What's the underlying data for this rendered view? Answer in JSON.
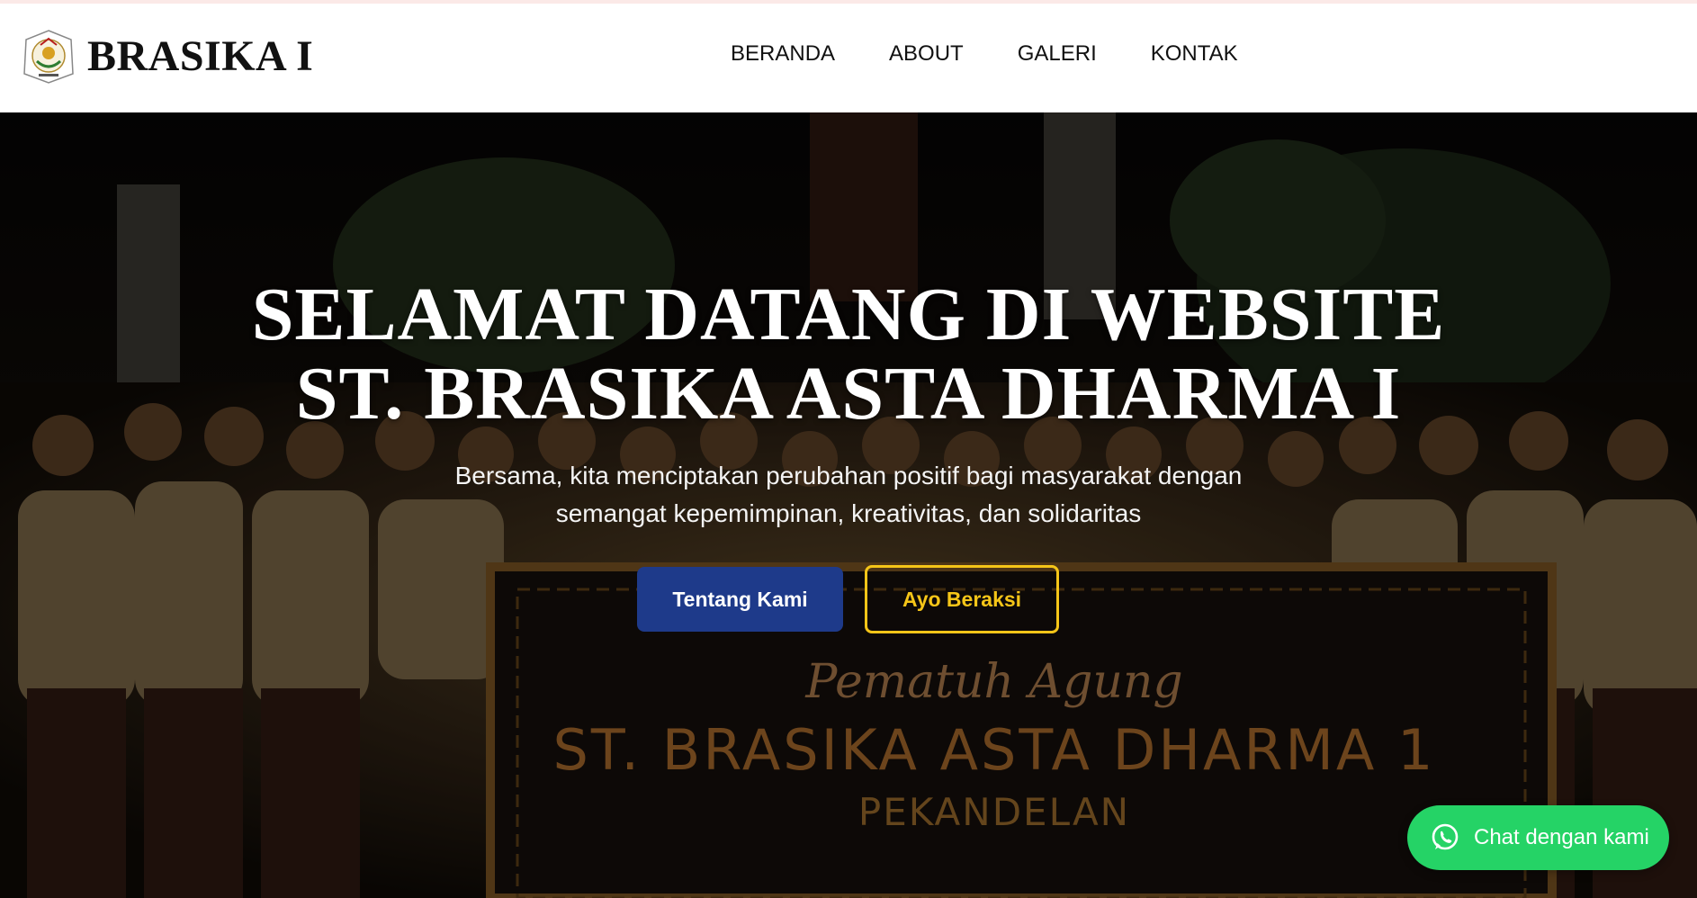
{
  "brand": {
    "name": "BRASIKA I",
    "logo_icon": "organization-emblem-icon"
  },
  "nav": {
    "items": [
      "BERANDA",
      "ABOUT",
      "GALERI",
      "KONTAK"
    ]
  },
  "hero": {
    "title_line1": "SELAMAT DATANG DI WEBSITE",
    "title_line2": "ST. BRASIKA ASTA DHARMA I",
    "subtitle_line1": "Bersama, kita menciptakan perubahan positif bagi masyarakat dengan",
    "subtitle_line2": "semangat kepemimpinan, kreativitas, dan solidaritas",
    "primary_button": "Tentang Kami",
    "secondary_button": "Ayo Beraksi",
    "banner_script": "Pematuh Agung",
    "banner_title": "ST. BRASIKA ASTA DHARMA 1",
    "banner_subtitle": "PEKANDELAN"
  },
  "chat": {
    "label": "Chat dengan kami",
    "icon": "whatsapp-icon"
  },
  "colors": {
    "primary": "#1e3a8a",
    "accent": "#f5c518",
    "whatsapp": "#25d366",
    "banner_text": "#c6822f"
  }
}
